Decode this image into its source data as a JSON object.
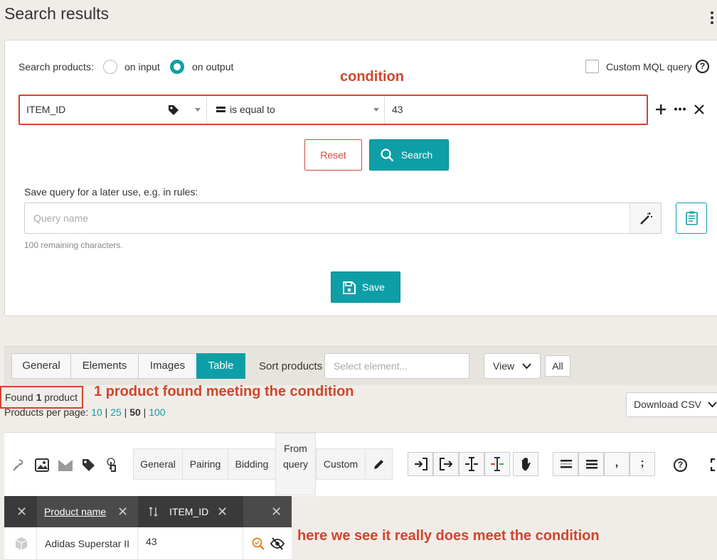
{
  "page": {
    "title": "Search results"
  },
  "search": {
    "label": "Search products:",
    "radio_input": "on input",
    "radio_output": "on output",
    "custom_mql": "Custom MQL query",
    "condition_annotation": "condition",
    "field": "ITEM_ID",
    "operator": "is equal to",
    "value": "43",
    "reset": "Reset",
    "search": "Search"
  },
  "save": {
    "label": "Save query for a later use, e.g. in rules:",
    "placeholder": "Query name",
    "remaining": "100 remaining characters.",
    "button": "Save"
  },
  "results": {
    "tabs": [
      "General",
      "Elements",
      "Images",
      "Table"
    ],
    "active_tab": "Table",
    "sort_label": "Sort products",
    "sort_placeholder": "Select element...",
    "view": "View",
    "all": "All",
    "found_prefix": "Found",
    "found_count": "1",
    "found_suffix": "product",
    "found_annotation": "1 product found meeting the condition",
    "per_page_label": "Products per page:",
    "per_page_options": [
      "10",
      "25",
      "50",
      "100"
    ],
    "per_page_selected": "50",
    "download": "Download CSV"
  },
  "grid": {
    "group_buttons": [
      "General",
      "Pairing",
      "Bidding",
      "From query",
      "Custom"
    ],
    "columns": [
      "Product name",
      "ITEM_ID"
    ],
    "rows": [
      {
        "name": "Adidas Superstar II",
        "item_id": "43"
      }
    ],
    "row_annotation": "here we see it really does meet the condition"
  },
  "colors": {
    "accent": "#0e9fa6",
    "annotation": "#d2452b",
    "danger": "#d04a3f"
  }
}
